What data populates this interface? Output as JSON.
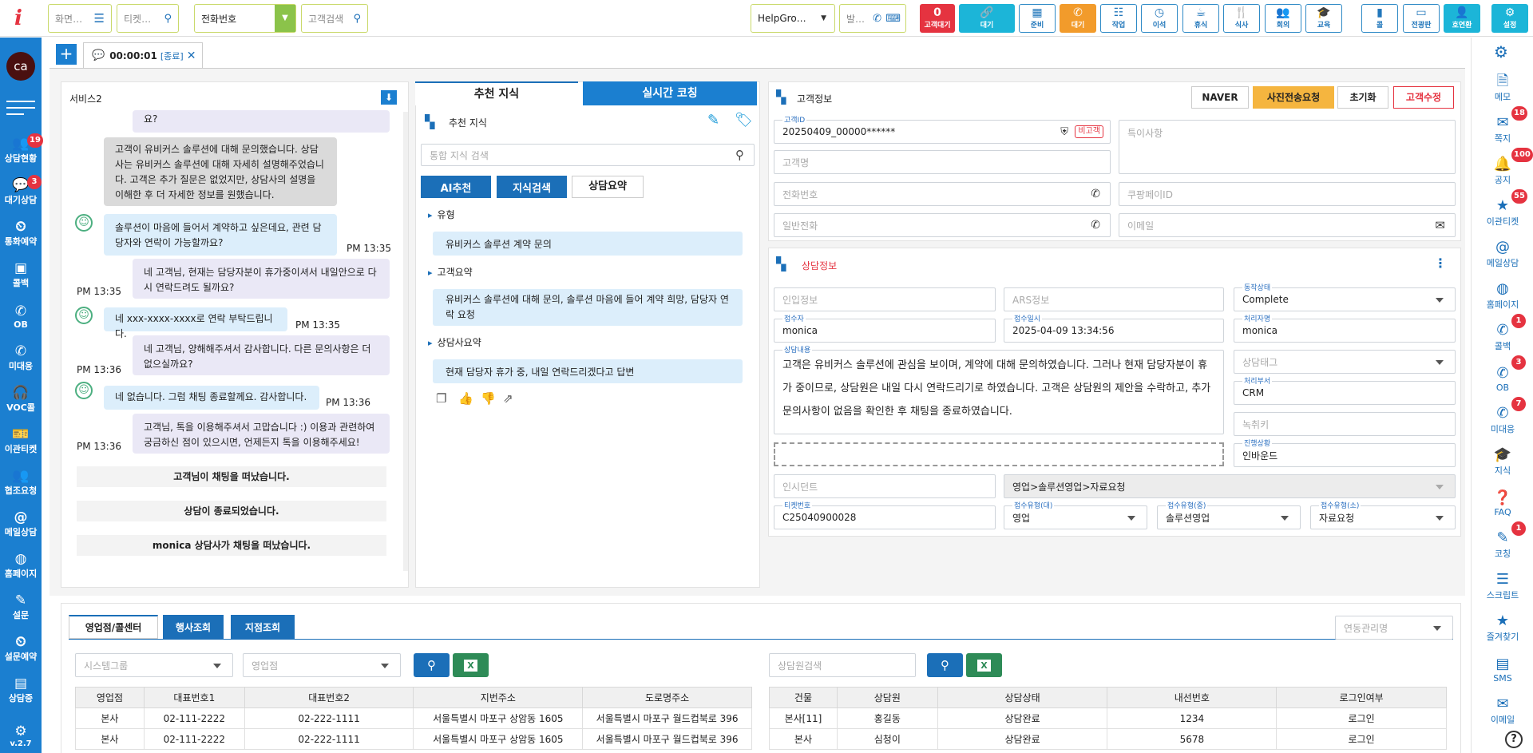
{
  "topbar": {
    "screen_placeholder": "화면…",
    "ticket_placeholder": "티켓…",
    "phone_select": "전화번호",
    "customer_search_placeholder": "고객검색",
    "group_select": "HelpGro…",
    "outgoing_placeholder": "발…",
    "waiting_count": "0",
    "waiting_label": "고객대기",
    "status_buttons": [
      "대기",
      "준비",
      "대기",
      "작업",
      "이석",
      "휴식",
      "식사",
      "회의",
      "교육"
    ],
    "right_buttons": [
      "콜",
      "전광판",
      "호연환",
      "설정"
    ]
  },
  "leftnav": {
    "avatar": "ca",
    "items": [
      "상담현황",
      "대기상담",
      "통화예약",
      "콜백",
      "OB",
      "미대응",
      "VOC콜",
      "이관티켓",
      "협조요청",
      "메일상담",
      "홈페이지",
      "설문",
      "설문예약",
      "상담중"
    ],
    "badges": {
      "status": "19",
      "waiting": "3"
    },
    "version": "v.2.7"
  },
  "tabs": {
    "add": "+",
    "session_timer": "00:00:01",
    "session_status": "[종료]"
  },
  "chat": {
    "title": "서비스2",
    "top_fragment": "요?",
    "summary": "고객이 유비커스 솔루션에 대해 문의했습니다. 상담사는 유비커스 솔루션에 대해 자세히 설명해주었습니다. 고객은 추가 질문은 없었지만, 상담사의 설명을 이해한 후 더 자세한 정보를 원했습니다.",
    "messages": [
      {
        "text": "솔루션이 마음에 들어서 계약하고 싶은데요, 관련 담당자와 연락이 가능할까요?",
        "time": "PM 13:35"
      },
      {
        "text": "네 고객님, 현재는 담당자분이 휴가중이셔서 내일안으로 다시 연락드려도 될까요?",
        "time": "PM 13:35"
      },
      {
        "text": "네 xxx-xxxx-xxxx로 연락 부탁드립니다.",
        "time": "PM 13:35"
      },
      {
        "text": "네 고객님, 양해해주셔서 감사합니다. 다른 문의사항은 더 없으실까요?",
        "time": "PM 13:36"
      },
      {
        "text": "네 없습니다. 그럼 채팅 종료할께요. 감사합니다.",
        "time": "PM 13:36"
      },
      {
        "text": "고객님, 톡을 이용해주셔서 고맙습니다 :) 이용과 관련하여 궁금하신 점이 있으시면, 언제든지 톡을 이용해주세요!",
        "time": "PM 13:36"
      }
    ],
    "system": [
      "고객님이 채팅을 떠났습니다.",
      "상담이 종료되었습니다.",
      "monica 상담사가 채팅을 떠났습니다."
    ]
  },
  "knowledge": {
    "tab_recommend": "추천 지식",
    "tab_coaching": "실시간 코칭",
    "section_title": "추천 지식",
    "search_placeholder": "통합 지식 검색",
    "btn_ai": "AI추천",
    "btn_search": "지식검색",
    "btn_summary": "상담요약",
    "type_label": "유형",
    "type_value": "유비커스 솔루션 계약 문의",
    "customer_summary_label": "고객요약",
    "customer_summary_value": "유비커스 솔루션에 대해 문의, 솔루션 마음에 들어 계약 희망, 담당자 연락 요청",
    "agent_summary_label": "상담사요약",
    "agent_summary_value": "현재 담당자 휴가 중, 내일 연락드리겠다고 답변"
  },
  "customer": {
    "title": "고객정보",
    "btn_naver": "NAVER",
    "btn_photo": "사진전송요청",
    "btn_reset": "초기화",
    "btn_edit": "고객수정",
    "id_label": "고객ID",
    "id_value": "20250409_00000******",
    "id_tag": "비고객",
    "name_placeholder": "고객명",
    "phone_placeholder": "전화번호",
    "general_phone_placeholder": "일반전화",
    "note_placeholder": "특이사항",
    "coupang_placeholder": "쿠팡페이ID",
    "email_placeholder": "이메일"
  },
  "consult": {
    "title": "상담정보",
    "inflow_placeholder": "인입정보",
    "ars_placeholder": "ARS정보",
    "status_label": "동작상태",
    "status_value": "Complete",
    "receiver_label": "접수자",
    "receiver_value": "monica",
    "receive_time_label": "접수일시",
    "receive_time_value": "2025-04-09 13:34:56",
    "handler_label": "처리자명",
    "handler_value": "monica",
    "content_label": "상담내용",
    "content_value": "고객은 유비커스 솔루션에 관심을 보이며, 계약에 대해 문의하였습니다. 그러나 현재 담당자분이 휴가 중이므로, 상담원은 내일 다시 연락드리기로 하였습니다. 고객은 상담원의 제안을 수락하고, 추가 문의사항이 없음을 확인한 후 채팅을 종료하였습니다.",
    "tag_placeholder": "상담태그",
    "dept_label": "처리부서",
    "dept_value": "CRM",
    "record_placeholder": "녹취키",
    "progress_label": "진행상황",
    "progress_value": "인바운드",
    "incident_placeholder": "인시던트",
    "category_path": "영업>솔루션영업>자료요청",
    "ticket_label": "티켓번호",
    "ticket_value": "C25040900028",
    "type_large_label": "접수유형(대)",
    "type_large_value": "영업",
    "type_mid_label": "접수유형(중)",
    "type_mid_value": "솔루션영업",
    "type_small_label": "접수유형(소)",
    "type_small_value": "자료요청"
  },
  "bottom": {
    "tab_branch": "영업점/콜센터",
    "tab_partner": "행사조회",
    "tab_point": "지점조회",
    "contact_select": "연동관리명",
    "system_group_placeholder": "시스템그룹",
    "branch_placeholder": "영업점",
    "agent_search_placeholder": "상담원검색",
    "branch_table": {
      "headers": [
        "영업점",
        "대표번호1",
        "대표번호2",
        "지번주소",
        "도로명주소"
      ],
      "rows": [
        [
          "본사",
          "02-111-2222",
          "02-222-1111",
          "서울특별시 마포구 상암동 1605",
          "서울특별시 마포구 월드컵북로 396"
        ],
        [
          "본사",
          "02-111-2222",
          "02-222-1111",
          "서울특별시 마포구 상암동 1605",
          "서울특별시 마포구 월드컵북로 396"
        ]
      ]
    },
    "agent_table": {
      "headers": [
        "건물",
        "상담원",
        "상담상태",
        "내선번호",
        "로그인여부"
      ],
      "rows": [
        [
          "본사[11]",
          "홍길동",
          "상담완료",
          "1234",
          "로그인"
        ],
        [
          "본사",
          "심청이",
          "상담완료",
          "5678",
          "로그인"
        ]
      ]
    }
  },
  "rightnav": {
    "items": [
      "메모",
      "쪽지",
      "공지",
      "이관티켓",
      "메일상담",
      "홈페이지",
      "콜백",
      "OB",
      "미대응",
      "지식",
      "FAQ",
      "코칭",
      "스크립트",
      "즐겨찾기",
      "SMS",
      "이메일"
    ],
    "badges": {
      "note": "18",
      "notice": "100",
      "transfer": "55",
      "callback": "1",
      "ob": "3",
      "missed": "7",
      "coaching": "1"
    }
  },
  "colors": {
    "accent": "#1b6fb8",
    "nav": "#1b7fd0",
    "green": "#8bc34a",
    "orange": "#f29b2b",
    "red": "#e53340",
    "cyan": "#1cb5d8"
  }
}
